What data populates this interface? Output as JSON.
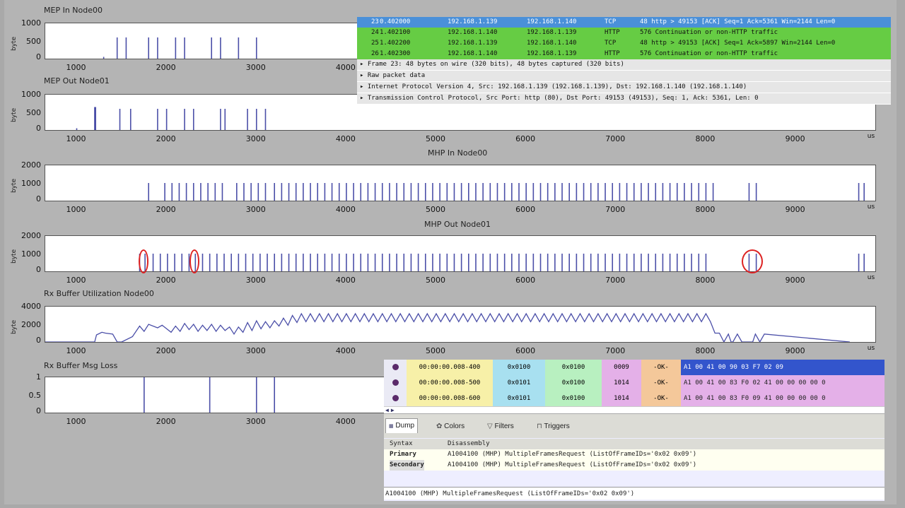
{
  "charts": [
    {
      "title": "MEP In Node00",
      "ylabel": "byte",
      "yticks": [
        "1000",
        "500",
        "0"
      ],
      "xticks": [
        "1000",
        "2000",
        "3000",
        "4000"
      ],
      "unit": ""
    },
    {
      "title": "MEP Out Node01",
      "ylabel": "byte",
      "yticks": [
        "1000",
        "500",
        "0"
      ],
      "xticks": [
        "1000",
        "2000",
        "3000",
        "4000",
        "5000",
        "6000",
        "7000",
        "8000",
        "9000"
      ],
      "unit": "us"
    },
    {
      "title": "MHP In Node00",
      "ylabel": "byte",
      "yticks": [
        "2000",
        "1000",
        "0"
      ],
      "xticks": [
        "1000",
        "2000",
        "3000",
        "4000",
        "5000",
        "6000",
        "7000",
        "8000",
        "9000"
      ],
      "unit": "us"
    },
    {
      "title": "MHP Out Node01",
      "ylabel": "byte",
      "yticks": [
        "2000",
        "1000",
        "0"
      ],
      "xticks": [
        "1000",
        "2000",
        "3000",
        "4000",
        "5000",
        "6000",
        "7000",
        "8000",
        "9000"
      ],
      "unit": "us"
    },
    {
      "title": "Rx Buffer Utilization Node00",
      "ylabel": "byte",
      "yticks": [
        "4000",
        "2000",
        "0"
      ],
      "xticks": [
        "1000",
        "2000",
        "3000",
        "4000",
        "5000",
        "6000",
        "7000",
        "8000",
        "9000"
      ],
      "unit": "us"
    },
    {
      "title": "Rx Buffer Msg Loss",
      "ylabel": "",
      "yticks": [
        "1",
        "0.5",
        "0"
      ],
      "xticks": [
        "1000",
        "2000",
        "3000",
        "4000"
      ],
      "unit": ""
    }
  ],
  "chart_data": [
    {
      "type": "bar",
      "title": "MEP In Node00",
      "xlim": [
        650,
        4500
      ],
      "ylim": [
        0,
        1000
      ],
      "x": [
        1300,
        1450,
        1550,
        1800,
        1900,
        2100,
        2200,
        2500,
        2600,
        2800,
        3000
      ],
      "values": [
        50,
        600,
        600,
        600,
        600,
        600,
        600,
        600,
        600,
        600,
        600
      ]
    },
    {
      "type": "bar",
      "title": "MEP Out Node01",
      "xlim": [
        650,
        9900
      ],
      "ylim": [
        0,
        1000
      ],
      "x": [
        1000,
        1200,
        1210,
        1480,
        1600,
        1900,
        2000,
        2200,
        2300,
        2600,
        2650,
        2900,
        3000,
        3100
      ],
      "values": [
        50,
        650,
        650,
        600,
        600,
        600,
        600,
        600,
        600,
        600,
        600,
        600,
        600,
        600
      ]
    },
    {
      "type": "bar",
      "title": "MHP In Node00",
      "xlim": [
        650,
        9900
      ],
      "ylim": [
        0,
        2000
      ],
      "x": [
        1800,
        1980,
        2060,
        2140,
        2220,
        2300,
        2380,
        2460,
        2540,
        2620,
        2780,
        2860,
        2940,
        3020,
        3100,
        3200,
        3280,
        3360,
        3440,
        3520,
        3600,
        3680,
        3760,
        3840,
        3920,
        4000,
        4080,
        4160,
        4240,
        4320,
        4400,
        4480,
        4560,
        4640,
        4720,
        4800,
        4880,
        4960,
        5040,
        5120,
        5200,
        5280,
        5360,
        5440,
        5520,
        5600,
        5680,
        5760,
        5840,
        5920,
        6000,
        6080,
        6160,
        6240,
        6320,
        6400,
        6480,
        6560,
        6640,
        6720,
        6800,
        6880,
        6960,
        7040,
        7120,
        7200,
        7280,
        7360,
        7440,
        7520,
        7600,
        7680,
        7760,
        7840,
        7920,
        8000,
        8080,
        8480,
        8560,
        9700,
        9760
      ],
      "values": [
        1000,
        1000,
        1000,
        1000,
        1000,
        1000,
        1000,
        1000,
        1000,
        1000,
        1000,
        1000,
        1000,
        1000,
        1000,
        1000,
        1000,
        1000,
        1000,
        1000,
        1000,
        1000,
        1000,
        1000,
        1000,
        1000,
        1000,
        1000,
        1000,
        1000,
        1000,
        1000,
        1000,
        1000,
        1000,
        1000,
        1000,
        1000,
        1000,
        1000,
        1000,
        1000,
        1000,
        1000,
        1000,
        1000,
        1000,
        1000,
        1000,
        1000,
        1000,
        1000,
        1000,
        1000,
        1000,
        1000,
        1000,
        1000,
        1000,
        1000,
        1000,
        1000,
        1000,
        1000,
        1000,
        1000,
        1000,
        1000,
        1000,
        1000,
        1000,
        1000,
        1000,
        1000,
        1000,
        1000,
        1000,
        1000,
        1000,
        1000,
        1000
      ]
    },
    {
      "type": "bar",
      "title": "MHP Out Node01",
      "xlim": [
        650,
        9900
      ],
      "ylim": [
        0,
        2000
      ],
      "x": [
        1700,
        1760,
        1850,
        1930,
        2010,
        2090,
        2170,
        2250,
        2320,
        2400,
        2480,
        2560,
        2640,
        2720,
        2800,
        2880,
        2960,
        3040,
        3120,
        3200,
        3280,
        3360,
        3440,
        3520,
        3600,
        3680,
        3760,
        3840,
        3920,
        4000,
        4080,
        4160,
        4240,
        4320,
        4400,
        4480,
        4560,
        4640,
        4720,
        4800,
        4880,
        4960,
        5040,
        5120,
        5200,
        5280,
        5360,
        5440,
        5520,
        5600,
        5680,
        5760,
        5840,
        5920,
        6000,
        6080,
        6160,
        6240,
        6320,
        6400,
        6480,
        6560,
        6640,
        6720,
        6800,
        6880,
        6960,
        7040,
        7120,
        7200,
        7280,
        7360,
        7440,
        7520,
        7600,
        7680,
        7760,
        7840,
        7920,
        8000,
        8480,
        8560,
        9700,
        9760
      ],
      "values": [
        1000,
        1000,
        1000,
        1000,
        1000,
        1000,
        1000,
        1000,
        1000,
        1000,
        1000,
        1000,
        1000,
        1000,
        1000,
        1000,
        1000,
        1000,
        1000,
        1000,
        1000,
        1000,
        1000,
        1000,
        1000,
        1000,
        1000,
        1000,
        1000,
        1000,
        1000,
        1000,
        1000,
        1000,
        1000,
        1000,
        1000,
        1000,
        1000,
        1000,
        1000,
        1000,
        1000,
        1000,
        1000,
        1000,
        1000,
        1000,
        1000,
        1000,
        1000,
        1000,
        1000,
        1000,
        1000,
        1000,
        1000,
        1000,
        1000,
        1000,
        1000,
        1000,
        1000,
        1000,
        1000,
        1000,
        1000,
        1000,
        1000,
        1000,
        1000,
        1000,
        1000,
        1000,
        1000,
        1000,
        1000,
        1000,
        1000,
        1000,
        1000,
        1000,
        1000,
        1000
      ],
      "highlights": [
        1750,
        2320,
        8520
      ]
    },
    {
      "type": "line",
      "title": "Rx Buffer Utilization Node00",
      "xlim": [
        650,
        9900
      ],
      "ylim": [
        0,
        4000
      ],
      "x": [
        650,
        1200,
        1220,
        1280,
        1320,
        1400,
        1450,
        1500,
        1620,
        1680,
        1700,
        1750,
        1800,
        1900,
        1950,
        2050,
        2100,
        2150,
        2200,
        2250,
        2300,
        2350,
        2400,
        2450,
        2500,
        2550,
        2600,
        2650,
        2700,
        2750,
        2800,
        2850,
        2900,
        2950,
        3000,
        3050,
        3100,
        3150,
        3200,
        3250,
        3300,
        3350,
        3400,
        3450,
        3500,
        3550,
        3600,
        3650,
        3700,
        3750,
        3800,
        3850,
        3900,
        3950,
        4000,
        4050,
        4100,
        4150,
        4200,
        4250,
        4300,
        4350,
        4400,
        4450,
        4500,
        4550,
        4600,
        4650,
        4700,
        4750,
        4800,
        4850,
        4900,
        4950,
        5000,
        5050,
        5100,
        5150,
        5200,
        5250,
        5300,
        5350,
        5400,
        5450,
        5500,
        5550,
        5600,
        5650,
        5700,
        5750,
        5800,
        5850,
        5900,
        5950,
        6000,
        6050,
        6100,
        6150,
        6200,
        6250,
        6300,
        6350,
        6400,
        6450,
        6500,
        6550,
        6600,
        6650,
        6700,
        6750,
        6800,
        6850,
        6900,
        6950,
        7000,
        7050,
        7100,
        7150,
        7200,
        7250,
        7300,
        7350,
        7400,
        7450,
        7500,
        7550,
        7600,
        7650,
        7700,
        7750,
        7800,
        7850,
        7900,
        7950,
        8000,
        8050,
        8100,
        8150,
        8200,
        8250,
        8280,
        8300,
        8350,
        8400,
        8420,
        8450,
        8500,
        8520,
        8550,
        8600,
        8650,
        9600,
        9650,
        9700,
        9750,
        9800,
        9850
      ],
      "values": [
        0,
        0,
        800,
        1100,
        1000,
        900,
        0,
        0,
        600,
        1500,
        1800,
        1200,
        2000,
        1600,
        1900,
        1100,
        1800,
        1200,
        2100,
        1400,
        2000,
        1200,
        1900,
        1300,
        2000,
        1200,
        1900,
        1300,
        1700,
        900,
        1700,
        1100,
        2200,
        1300,
        2400,
        1500,
        2300,
        1600,
        2400,
        1800,
        2700,
        1900,
        3000,
        2200,
        3200,
        2300,
        3200,
        2300,
        3200,
        2300,
        3200,
        2300,
        3200,
        2300,
        3200,
        2300,
        3200,
        2300,
        3200,
        2300,
        3200,
        2300,
        3200,
        2300,
        3200,
        2300,
        3200,
        2300,
        3200,
        2300,
        3200,
        2300,
        3200,
        2300,
        3200,
        2300,
        3200,
        2300,
        3200,
        2300,
        3200,
        2300,
        3200,
        2300,
        3200,
        2300,
        3200,
        2300,
        3200,
        2300,
        3200,
        2300,
        3200,
        2300,
        3200,
        2300,
        3200,
        2300,
        3200,
        2300,
        3200,
        2300,
        3200,
        2300,
        3200,
        2300,
        3200,
        2300,
        3200,
        2300,
        3200,
        2300,
        3200,
        2300,
        3200,
        2300,
        3200,
        2300,
        3200,
        2300,
        3200,
        2300,
        3200,
        2300,
        3200,
        2300,
        3200,
        2300,
        3200,
        2300,
        3200,
        2300,
        3200,
        2300,
        3200,
        2300,
        1000,
        1000,
        0,
        900,
        0,
        0,
        900,
        0,
        0,
        0,
        0,
        0,
        900,
        0,
        900,
        0
      ]
    },
    {
      "type": "bar",
      "title": "Rx Buffer Msg Loss",
      "xlim": [
        650,
        4500
      ],
      "ylim": [
        0,
        1
      ],
      "x": [
        1750,
        2480,
        3000,
        3200
      ],
      "values": [
        1,
        1,
        1,
        1
      ]
    }
  ],
  "wireshark": {
    "packets": [
      {
        "no": "23",
        "time": "0.402000",
        "src": "192.168.1.139",
        "dst": "192.168.1.140",
        "proto": "TCP",
        "info": "48 http > 49153 [ACK] Seq=1 Ack=5361 Win=2144 Len=0",
        "color": "#4a90d9",
        "text_color": "#ffffff"
      },
      {
        "no": "24",
        "time": "1.402100",
        "src": "192.168.1.140",
        "dst": "192.168.1.139",
        "proto": "HTTP",
        "info": "576 Continuation or non-HTTP traffic",
        "color": "#66cc44",
        "text_color": "#111111"
      },
      {
        "no": "25",
        "time": "1.402200",
        "src": "192.168.1.139",
        "dst": "192.168.1.140",
        "proto": "TCP",
        "info": "48 http > 49153 [ACK] Seq=1 Ack=5897 Win=2144 Len=0",
        "color": "#66cc44",
        "text_color": "#111111"
      },
      {
        "no": "26",
        "time": "1.402300",
        "src": "192.168.1.140",
        "dst": "192.168.1.139",
        "proto": "HTTP",
        "info": "576 Continuation or non-HTTP traffic",
        "color": "#66cc44",
        "text_color": "#111111"
      }
    ],
    "details": [
      "▸ Frame 23: 48 bytes on wire (320 bits), 48 bytes captured (320 bits)",
      "▸ Raw packet data",
      "▸ Internet Protocol Version 4, Src: 192.168.1.139 (192.168.1.139), Dst: 192.168.1.140 (192.168.1.140)",
      "▸ Transmission Control Protocol, Src Port: http (80), Dst Port: 49153 (49153), Seq: 1, Ack: 5361, Len: 0"
    ]
  },
  "analyzer": {
    "rows": [
      {
        "time": "00:00:00.008-400",
        "id1": "0x0100",
        "id2": "0x0100",
        "len": "0009",
        "status": "-OK-",
        "data": "A1 00 41 00 90 03 F7 02 09"
      },
      {
        "time": "00:00:00.008-500",
        "id1": "0x0101",
        "id2": "0x0100",
        "len": "1014",
        "status": "-OK-",
        "data": "A1 00 41 00 83 F0 02 41 00 00 00 00 0"
      },
      {
        "time": "00:00:00.008-600",
        "id1": "0x0101",
        "id2": "0x0100",
        "len": "1014",
        "status": "-OK-",
        "data": "A1 00 41 00 83 F0 09 41 00 00 00 00 0"
      }
    ],
    "tabs": [
      "Dump",
      "Colors",
      "Filters",
      "Triggers"
    ],
    "syntax_header": "Syntax",
    "disasm_header": "Disassembly",
    "syntax_rows": [
      {
        "label": "Primary",
        "text": "A1004100 (MHP) MultipleFramesRequest (ListOfFrameIDs='0x02 0x09')"
      },
      {
        "label": "Secondary",
        "text": "A1004100 (MHP) MultipleFramesRequest (ListOfFrameIDs='0x02 0x09')"
      }
    ],
    "bottom_text": "A1004100 (MHP) MultipleFramesRequest (ListOfFrameIDs='0x02 0x09')"
  },
  "colors": {
    "trace": "#4b4fa8",
    "marker": "#dd2222"
  }
}
